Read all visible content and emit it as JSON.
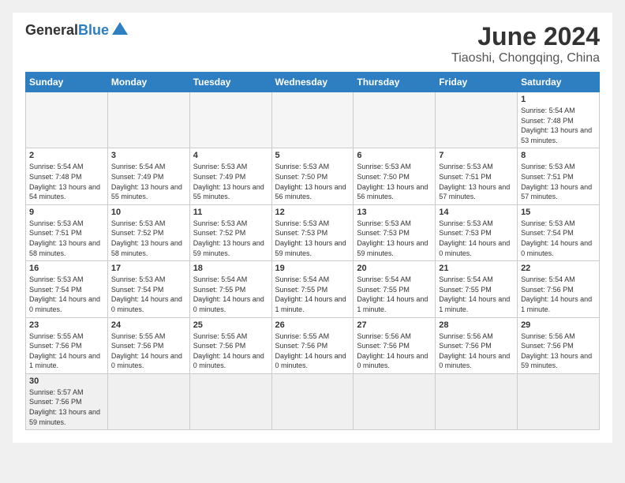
{
  "header": {
    "logo_general": "General",
    "logo_blue": "Blue",
    "month_year": "June 2024",
    "location": "Tiaoshi, Chongqing, China"
  },
  "days_of_week": [
    "Sunday",
    "Monday",
    "Tuesday",
    "Wednesday",
    "Thursday",
    "Friday",
    "Saturday"
  ],
  "weeks": [
    [
      {
        "day": "",
        "info": ""
      },
      {
        "day": "",
        "info": ""
      },
      {
        "day": "",
        "info": ""
      },
      {
        "day": "",
        "info": ""
      },
      {
        "day": "",
        "info": ""
      },
      {
        "day": "",
        "info": ""
      },
      {
        "day": "1",
        "info": "Sunrise: 5:54 AM\nSunset: 7:48 PM\nDaylight: 13 hours and 53 minutes."
      }
    ],
    [
      {
        "day": "2",
        "info": "Sunrise: 5:54 AM\nSunset: 7:48 PM\nDaylight: 13 hours and 54 minutes."
      },
      {
        "day": "3",
        "info": "Sunrise: 5:54 AM\nSunset: 7:49 PM\nDaylight: 13 hours and 55 minutes."
      },
      {
        "day": "4",
        "info": "Sunrise: 5:53 AM\nSunset: 7:49 PM\nDaylight: 13 hours and 55 minutes."
      },
      {
        "day": "5",
        "info": "Sunrise: 5:53 AM\nSunset: 7:50 PM\nDaylight: 13 hours and 56 minutes."
      },
      {
        "day": "6",
        "info": "Sunrise: 5:53 AM\nSunset: 7:50 PM\nDaylight: 13 hours and 56 minutes."
      },
      {
        "day": "7",
        "info": "Sunrise: 5:53 AM\nSunset: 7:51 PM\nDaylight: 13 hours and 57 minutes."
      },
      {
        "day": "8",
        "info": "Sunrise: 5:53 AM\nSunset: 7:51 PM\nDaylight: 13 hours and 57 minutes."
      }
    ],
    [
      {
        "day": "9",
        "info": "Sunrise: 5:53 AM\nSunset: 7:51 PM\nDaylight: 13 hours and 58 minutes."
      },
      {
        "day": "10",
        "info": "Sunrise: 5:53 AM\nSunset: 7:52 PM\nDaylight: 13 hours and 58 minutes."
      },
      {
        "day": "11",
        "info": "Sunrise: 5:53 AM\nSunset: 7:52 PM\nDaylight: 13 hours and 59 minutes."
      },
      {
        "day": "12",
        "info": "Sunrise: 5:53 AM\nSunset: 7:53 PM\nDaylight: 13 hours and 59 minutes."
      },
      {
        "day": "13",
        "info": "Sunrise: 5:53 AM\nSunset: 7:53 PM\nDaylight: 13 hours and 59 minutes."
      },
      {
        "day": "14",
        "info": "Sunrise: 5:53 AM\nSunset: 7:53 PM\nDaylight: 14 hours and 0 minutes."
      },
      {
        "day": "15",
        "info": "Sunrise: 5:53 AM\nSunset: 7:54 PM\nDaylight: 14 hours and 0 minutes."
      }
    ],
    [
      {
        "day": "16",
        "info": "Sunrise: 5:53 AM\nSunset: 7:54 PM\nDaylight: 14 hours and 0 minutes."
      },
      {
        "day": "17",
        "info": "Sunrise: 5:53 AM\nSunset: 7:54 PM\nDaylight: 14 hours and 0 minutes."
      },
      {
        "day": "18",
        "info": "Sunrise: 5:54 AM\nSunset: 7:55 PM\nDaylight: 14 hours and 0 minutes."
      },
      {
        "day": "19",
        "info": "Sunrise: 5:54 AM\nSunset: 7:55 PM\nDaylight: 14 hours and 1 minute."
      },
      {
        "day": "20",
        "info": "Sunrise: 5:54 AM\nSunset: 7:55 PM\nDaylight: 14 hours and 1 minute."
      },
      {
        "day": "21",
        "info": "Sunrise: 5:54 AM\nSunset: 7:55 PM\nDaylight: 14 hours and 1 minute."
      },
      {
        "day": "22",
        "info": "Sunrise: 5:54 AM\nSunset: 7:56 PM\nDaylight: 14 hours and 1 minute."
      }
    ],
    [
      {
        "day": "23",
        "info": "Sunrise: 5:55 AM\nSunset: 7:56 PM\nDaylight: 14 hours and 1 minute."
      },
      {
        "day": "24",
        "info": "Sunrise: 5:55 AM\nSunset: 7:56 PM\nDaylight: 14 hours and 0 minutes."
      },
      {
        "day": "25",
        "info": "Sunrise: 5:55 AM\nSunset: 7:56 PM\nDaylight: 14 hours and 0 minutes."
      },
      {
        "day": "26",
        "info": "Sunrise: 5:55 AM\nSunset: 7:56 PM\nDaylight: 14 hours and 0 minutes."
      },
      {
        "day": "27",
        "info": "Sunrise: 5:56 AM\nSunset: 7:56 PM\nDaylight: 14 hours and 0 minutes."
      },
      {
        "day": "28",
        "info": "Sunrise: 5:56 AM\nSunset: 7:56 PM\nDaylight: 14 hours and 0 minutes."
      },
      {
        "day": "29",
        "info": "Sunrise: 5:56 AM\nSunset: 7:56 PM\nDaylight: 13 hours and 59 minutes."
      }
    ],
    [
      {
        "day": "30",
        "info": "Sunrise: 5:57 AM\nSunset: 7:56 PM\nDaylight: 13 hours and 59 minutes."
      },
      {
        "day": "",
        "info": ""
      },
      {
        "day": "",
        "info": ""
      },
      {
        "day": "",
        "info": ""
      },
      {
        "day": "",
        "info": ""
      },
      {
        "day": "",
        "info": ""
      },
      {
        "day": "",
        "info": ""
      }
    ]
  ]
}
